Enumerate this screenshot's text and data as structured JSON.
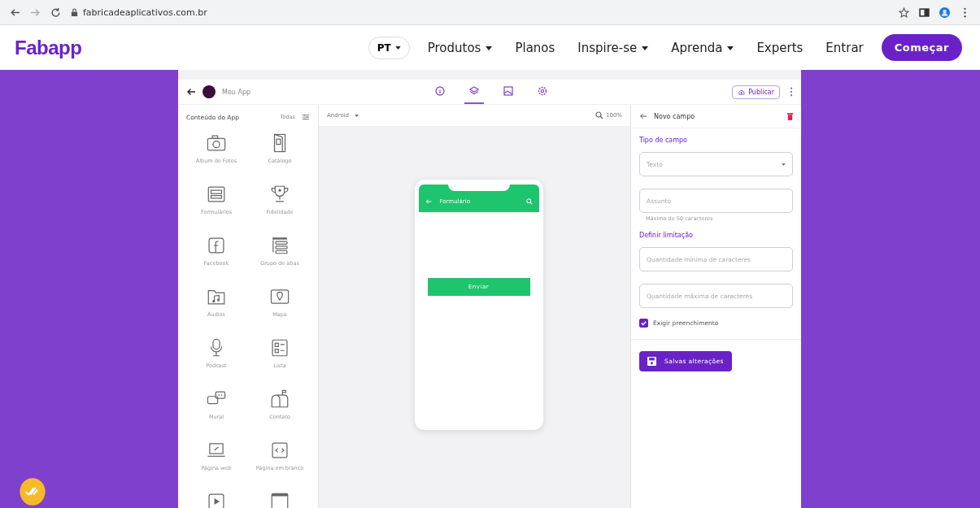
{
  "browser": {
    "url": "fabricadeaplicativos.com.br"
  },
  "site_nav": {
    "logo": "Fabapp",
    "language": "PT",
    "items": [
      {
        "label": "Produtos",
        "dropdown": true
      },
      {
        "label": "Planos",
        "dropdown": false
      },
      {
        "label": "Inspire-se",
        "dropdown": true
      },
      {
        "label": "Aprenda",
        "dropdown": true
      },
      {
        "label": "Experts",
        "dropdown": false
      }
    ],
    "login": "Entrar",
    "cta": "Começar"
  },
  "app": {
    "name": "Meu App",
    "header_tabs": [
      {
        "selected": false
      },
      {
        "selected": true
      },
      {
        "selected": false
      },
      {
        "selected": false
      }
    ],
    "publish": "Publicar",
    "sidebar": {
      "title": "Conteúdo do App",
      "filter": "Todas",
      "items": [
        {
          "label": "Álbum de Fotos"
        },
        {
          "label": "Catálogo"
        },
        {
          "label": "Formulários"
        },
        {
          "label": "Fidelidade"
        },
        {
          "label": "Facebook"
        },
        {
          "label": "Grupo de abas"
        },
        {
          "label": "Áudios"
        },
        {
          "label": "Mapa"
        },
        {
          "label": "Podcast"
        },
        {
          "label": "Lista"
        },
        {
          "label": "Mural"
        },
        {
          "label": "Contato"
        },
        {
          "label": "Página web"
        },
        {
          "label": "Página em branco"
        }
      ]
    },
    "canvas": {
      "platform": "Android",
      "zoom": "100%",
      "phone": {
        "title": "Formulário",
        "button": "Enviar"
      }
    },
    "panel": {
      "title": "Novo campo",
      "section": "Tipo de campo",
      "type_select": "Texto",
      "subject_placeholder": "Assunto",
      "hint": "Máximo de 50 caracteres",
      "limits_title": "Definir limitação",
      "min_placeholder": "Quantidade mínima de caracteres",
      "max_placeholder": "Quantidade máxima de caracteres",
      "required": {
        "label": "Exigir preenchimento",
        "checked": true
      },
      "save": "Salvas alterações"
    }
  }
}
